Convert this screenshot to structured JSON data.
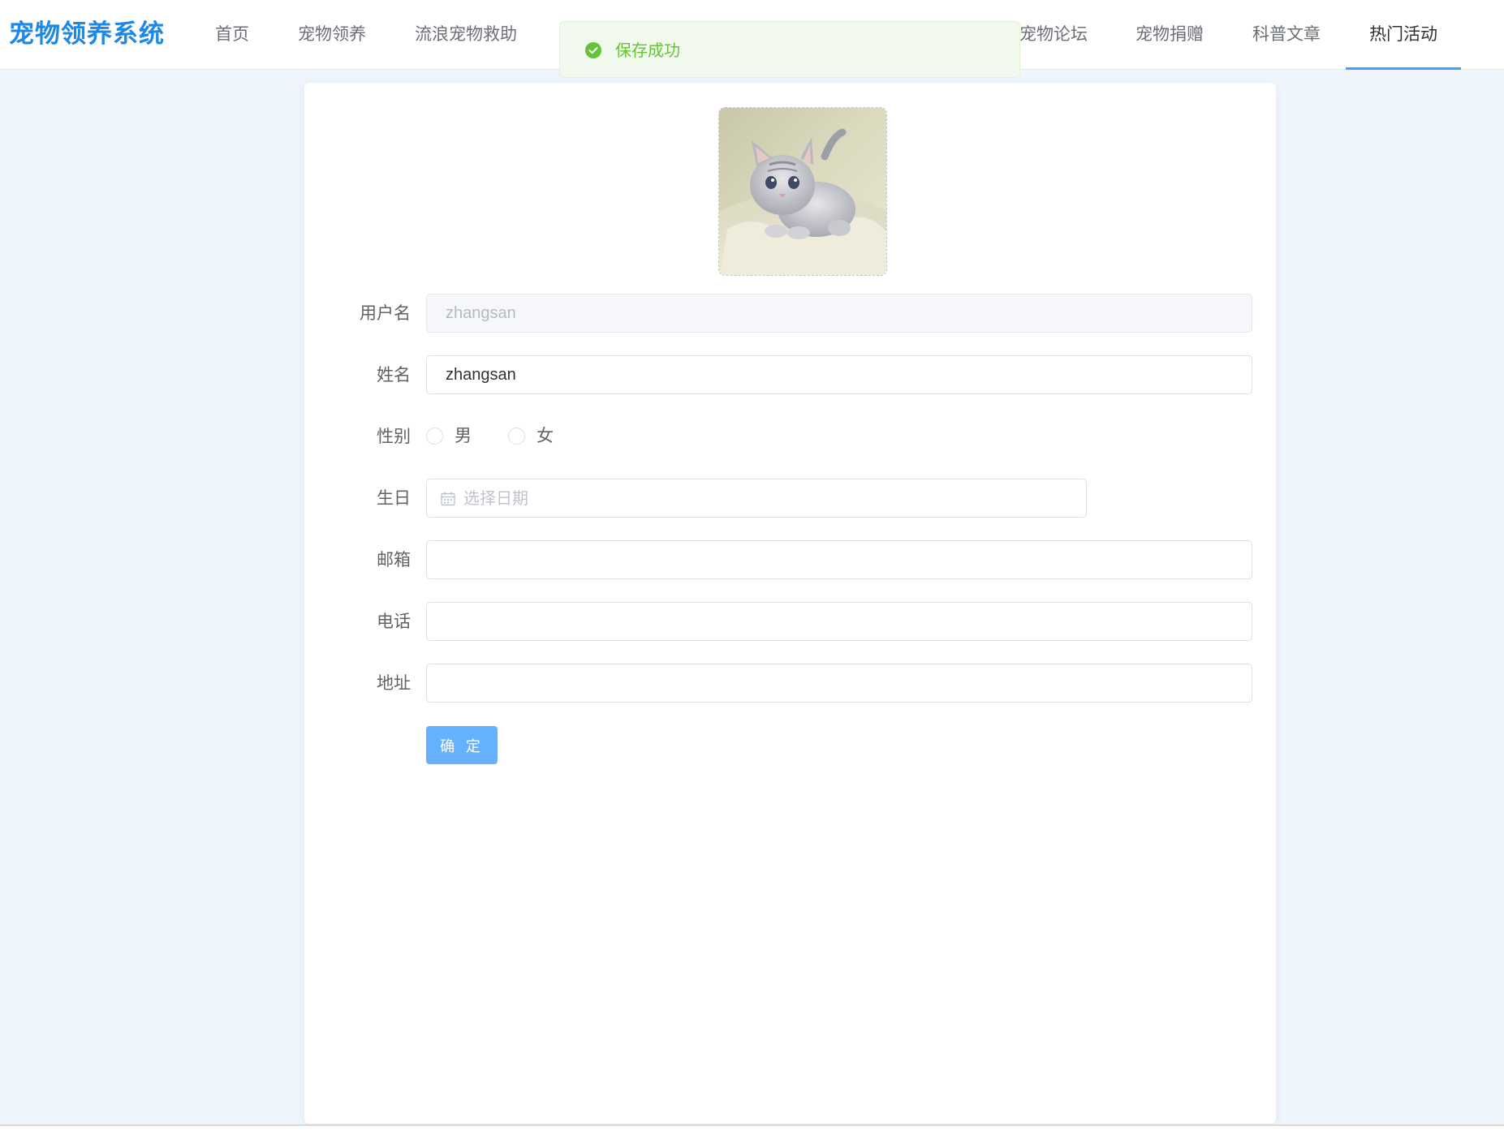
{
  "header": {
    "logo": "宠物领养系统",
    "nav": [
      {
        "label": "首页"
      },
      {
        "label": "宠物领养"
      },
      {
        "label": "流浪宠物救助"
      },
      {
        "label": "宠物论坛"
      },
      {
        "label": "宠物捐赠"
      },
      {
        "label": "科普文章"
      },
      {
        "label": "热门活动",
        "active": true
      }
    ]
  },
  "toast": {
    "message": "保存成功",
    "type": "success",
    "icon": "check-circle-icon"
  },
  "form": {
    "avatar": {
      "alt_icon": "kitten-photo"
    },
    "username": {
      "label": "用户名",
      "value": "zhangsan",
      "disabled": true
    },
    "name": {
      "label": "姓名",
      "value": "zhangsan"
    },
    "gender": {
      "label": "性别",
      "options": [
        "男",
        "女"
      ],
      "selected": null
    },
    "birthday": {
      "label": "生日",
      "placeholder": "选择日期",
      "icon": "calendar-icon"
    },
    "email": {
      "label": "邮箱",
      "value": ""
    },
    "phone": {
      "label": "电话",
      "value": ""
    },
    "address": {
      "label": "地址",
      "value": ""
    },
    "submit_label": "确 定"
  },
  "colors": {
    "brand": "#1e88e5",
    "active_nav_underline": "#409eff",
    "primary_button": "#66b1ff",
    "page_background": "#eef5fd",
    "toast_text": "#67c23a",
    "toast_background": "#f0f9eb"
  }
}
